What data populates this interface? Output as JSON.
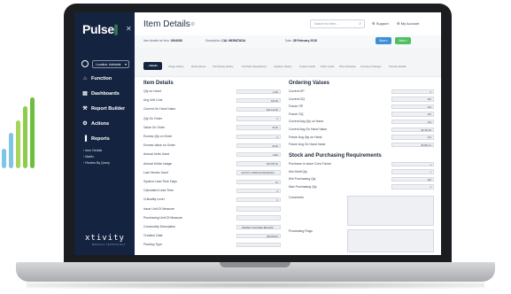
{
  "brand": {
    "app_name": "Pulse",
    "footer_logo": "xtivity",
    "footer_tagline": "MEDICAL TECHNOLOGY",
    "accent_color": "#4cc36b",
    "sidebar_color": "#14233f",
    "primary_button_color": "#3d8fd6",
    "success_button_color": "#4fbf63"
  },
  "sidebar": {
    "location_select": "Location: Adelaide",
    "items": [
      {
        "label": "Function",
        "icon": "home-icon"
      },
      {
        "label": "Dashboards",
        "icon": "dashboard-icon"
      },
      {
        "label": "Report Builder",
        "icon": "wrench-icon"
      },
      {
        "label": "Actions",
        "icon": "gear-icon"
      },
      {
        "label": "Reports",
        "icon": "chart-icon"
      }
    ],
    "sub_items": [
      "Item Details",
      "Matrix",
      "Review By Query"
    ]
  },
  "header": {
    "title": "Item Details",
    "search_placeholder": "Search for Item...",
    "support_label": "Support",
    "account_label": "My Account"
  },
  "info": {
    "item_label": "Item details for Item:",
    "item_value": "0004008",
    "desc_label": "Description:",
    "desc_value": "CAL HIDRATADA",
    "date_label": "Date:",
    "date_value": "28 February 2018",
    "save_label": "Save",
    "next_label": "Next"
  },
  "tabs": [
    "Details",
    "Usage History",
    "Reservations",
    "Purchasing History",
    "Purchase Requisitions",
    "Adoption History",
    "Custom Fields",
    "Other Loads",
    "Price Schedule",
    "Inventory Changes",
    "Transfer Details"
  ],
  "item_details": {
    "title": "Item Details",
    "fields": [
      {
        "label": "Qty on Hand",
        "value": "1,200"
      },
      {
        "label": "Avg Unit Cost",
        "value": "$18.40"
      },
      {
        "label": "Current On Hand Value",
        "value": "$22,140.00"
      },
      {
        "label": "Qty On Order",
        "value": "0"
      },
      {
        "label": "Value On Order",
        "value": "$0.00"
      },
      {
        "label": "Excess Qty on Order",
        "value": "0"
      },
      {
        "label": "Excess Value on Order",
        "value": "$0.00"
      },
      {
        "label": "Annual Units Used",
        "value": "1,860"
      },
      {
        "label": "Annual Dollar Usage",
        "value": "$30,655.30"
      },
      {
        "label": "Last Vendor Used",
        "value": "GRUPO CAMBIUM REPRESEN"
      },
      {
        "label": "System Lead Time Days",
        "value": "10"
      },
      {
        "label": "Calculated Lead Time",
        "value": "9"
      },
      {
        "label": "Criticality Level",
        "value": "0"
      },
      {
        "label": "Issue Unit Of Measure",
        "value": ""
      },
      {
        "label": "Purchasing Unit Of Measure",
        "value": ""
      },
      {
        "label": "Commodity Description",
        "value": "BIENES COMUNES BECERS"
      },
      {
        "label": "Creation Date",
        "value": "08/23/2010"
      },
      {
        "label": "Packing Type",
        "value": ""
      }
    ]
  },
  "ordering_values": {
    "title": "Ordering Values",
    "fields": [
      {
        "label": "Current OP",
        "value": "0"
      },
      {
        "label": "Current OQ",
        "value": "400"
      },
      {
        "label": "Future OP",
        "value": "440"
      },
      {
        "label": "Future OQ",
        "value": "400"
      },
      {
        "label": "Current Avg Qty on Hand",
        "value": "343"
      },
      {
        "label": "Current Avg On Hand Value",
        "value": "$5,784.00"
      },
      {
        "label": "Future Avg Qty on Hand",
        "value": "424"
      },
      {
        "label": "Future Avg On Hand Value",
        "value": "$9,081.12"
      }
    ]
  },
  "stock_purchasing": {
    "title": "Stock and Purchasing Requirements",
    "fields": [
      {
        "label": "Purchase In Issue Conv Factor",
        "value": "1"
      },
      {
        "label": "Min Shelf Qty",
        "value": "1"
      },
      {
        "label": "Min Purchasing Qty",
        "value": "400"
      },
      {
        "label": "Max Purchasing Qty",
        "value": "4"
      }
    ],
    "comments_label": "Comments",
    "processing_flags_label": "Processing Flags"
  }
}
